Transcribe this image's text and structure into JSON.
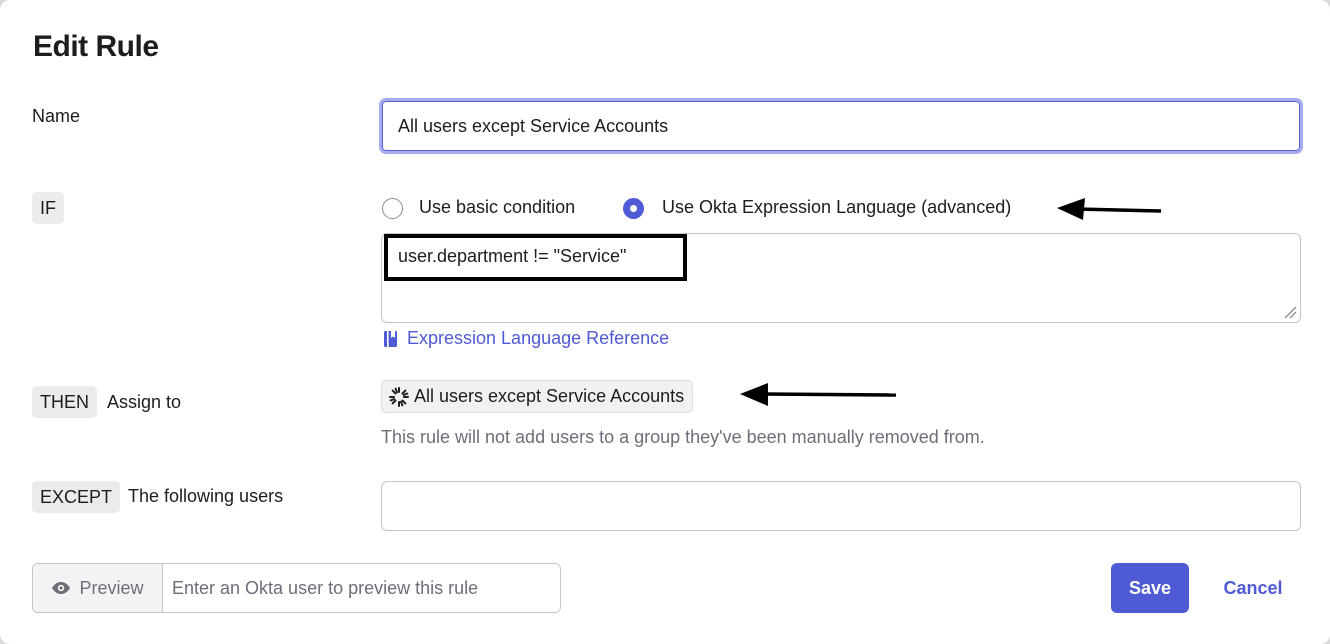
{
  "dialog": {
    "title": "Edit Rule"
  },
  "name_row": {
    "label": "Name",
    "value": "All users except Service Accounts"
  },
  "if_row": {
    "chip": "IF",
    "options": [
      {
        "label": "Use basic condition",
        "selected": false
      },
      {
        "label": "Use Okta Expression Language (advanced)",
        "selected": true
      }
    ],
    "expression": "user.department != \"Service\"",
    "reference_link": "Expression Language Reference"
  },
  "then_row": {
    "chip": "THEN",
    "label": "Assign to",
    "group": "All users except Service Accounts",
    "hint": "This rule will not add users to a group they've been manually removed from."
  },
  "except_row": {
    "chip": "EXCEPT",
    "label": "The following users",
    "value": ""
  },
  "footer": {
    "preview_label": "Preview",
    "preview_placeholder": "Enter an Okta user to preview this rule",
    "save_label": "Save",
    "cancel_label": "Cancel"
  },
  "icons": {
    "preview": "eye-icon",
    "reference": "book-icon",
    "group": "group-starburst-icon",
    "annotation": "arrow-left-icon"
  },
  "colors": {
    "accent": "#4f5bd5",
    "focus_ring": "#a7acf0",
    "chip_bg": "#ebebed",
    "hint_text": "#6e6e78"
  }
}
